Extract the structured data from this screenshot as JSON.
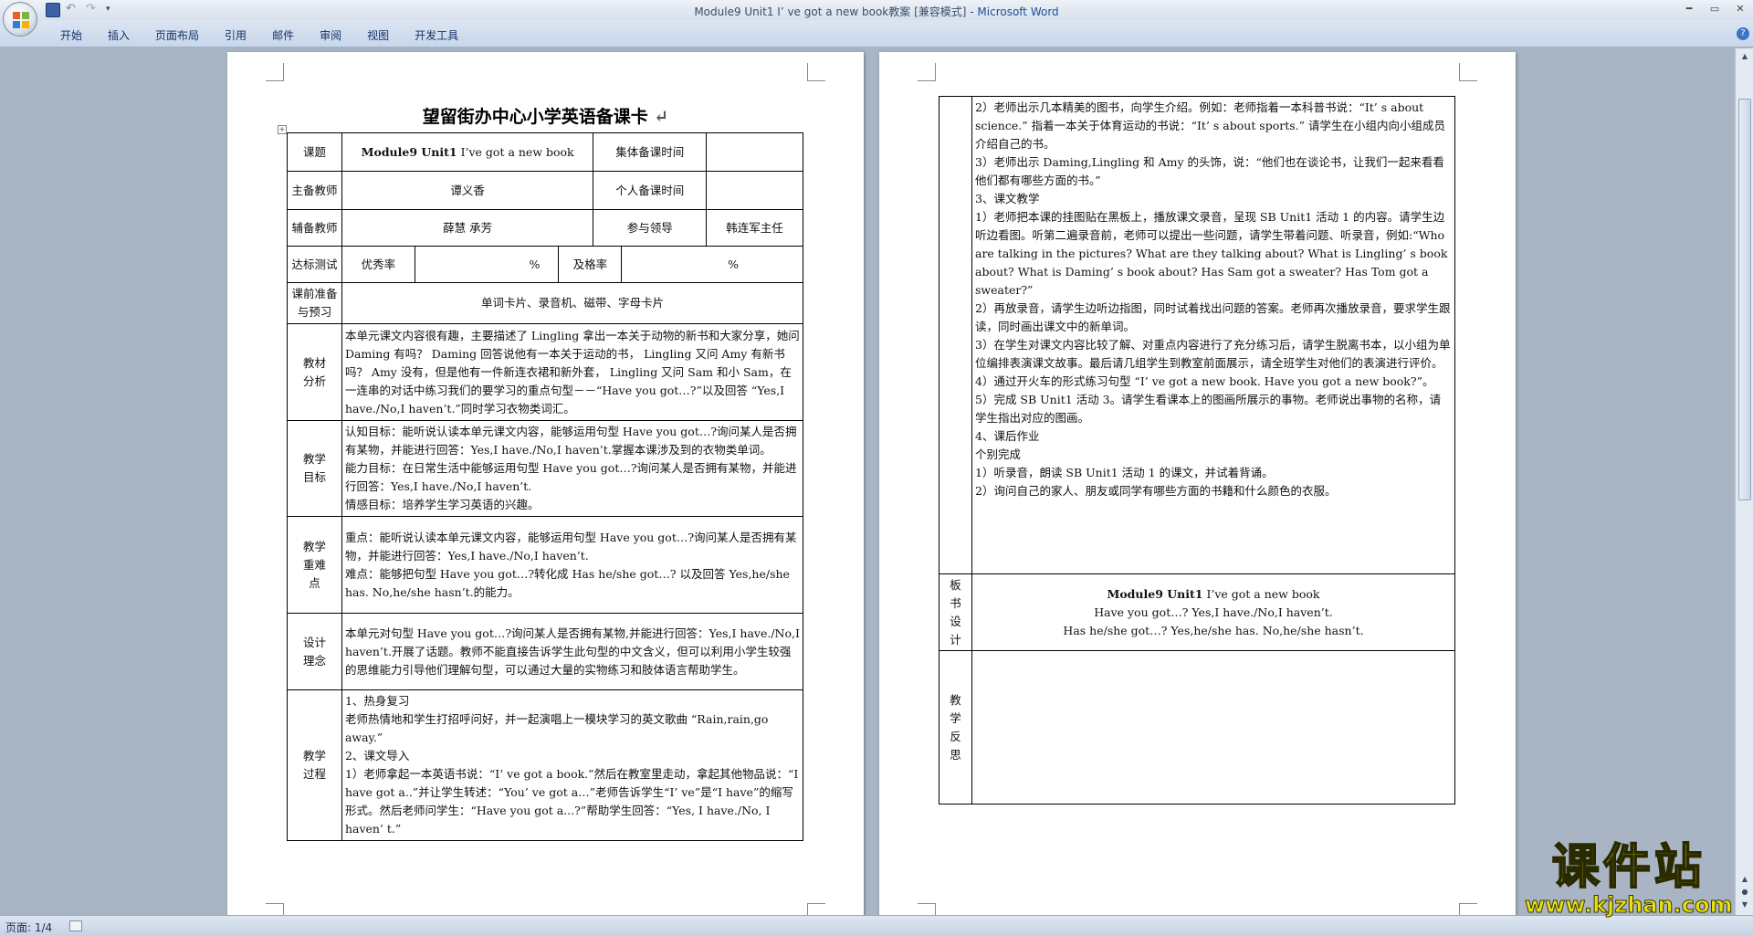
{
  "window": {
    "title": "Module9 Unit1 I’ ve got a new book教案 [兼容模式]",
    "app_name": "Microsoft Word",
    "separator": " - "
  },
  "ribbon": {
    "tabs": [
      "开始",
      "插入",
      "页面布局",
      "引用",
      "邮件",
      "审阅",
      "视图",
      "开发工具"
    ]
  },
  "status": {
    "page": "页面: 1/4"
  },
  "doc": {
    "title": "望留街办中心小学英语备课卡",
    "lesson_label": "课题",
    "lesson_value_bold": "Module9 Unit1",
    "lesson_value_rest": " I’ve got a new book",
    "collective_time_label": "集体备课时间",
    "main_teacher_label": "主备教师",
    "main_teacher_value": "谭义香",
    "personal_time_label": "个人备课时间",
    "assist_teacher_label": "辅备教师",
    "assist_teacher_value": "薛慧  承芳",
    "leader_label": "参与领导",
    "leader_value": "韩连军主任",
    "test_label": "达标测试",
    "excellent_label": "优秀率",
    "percent": "%",
    "pass_label": "及格率",
    "prep_label": "课前准备与预习",
    "prep_value": "单词卡片、录音机、磁带、字母卡片",
    "material_label": "教材分析",
    "material_text": "本单元课文内容很有趣，主要描述了 Lingling 拿出一本关于动物的新书和大家分享，她问 Daming 有吗？ Daming 回答说他有一本关于运动的书，  Lingling 又问  Amy 有新书吗？  Amy 没有，但是他有一件新连衣裙和新外套，   Lingling 又问  Sam 和小 Sam，在一连串的对话中练习我们的要学习的重点句型－－“Have you got…?”以及回答 “Yes,I have./No,I haven’t.”同时学习衣物类词汇。",
    "goal_label": "教学目标",
    "goal_lines": [
      "认知目标：能听说认读本单元课文内容，能够运用句型 Have you got…?询问某人是否拥有某物，并能进行回答：Yes,I have./No,I haven’t.掌握本课涉及到的衣物类单词。",
      "能力目标：在日常生活中能够运用句型 Have you got…?询问某人是否拥有某物，并能进行回答：Yes,I have./No,I haven’t.",
      "情感目标：培养学生学习英语的兴趣。"
    ],
    "key_label": "教学重难点",
    "key_lines": [
      "重点：能听说认读本单元课文内容，能够运用句型 Have you got…?询问某人是否拥有某物，并能进行回答：Yes,I have./No,I haven’t.",
      "难点：能够把句型 Have you got…?转化成 Has he/she got…? 以及回答 Yes,he/she has. No,he/she hasn’t.的能力。"
    ],
    "design_label": "设计理念",
    "design_text": "本单元对句型 Have you got…?询问某人是否拥有某物,并能进行回答：Yes,I have./No,I haven’t.开展了话题。教师不能直接告诉学生此句型的中文含义，但可以利用小学生较强的思维能力引导他们理解句型，可以通过大量的实物练习和肢体语言帮助学生。",
    "process_label": "教学过程",
    "process_left_lines": [
      "1、热身复习",
      "老师热情地和学生打招呼问好，并一起演唱上一模块学习的英文歌曲 “Rain,rain,go away.”",
      "2、课文导入",
      "1）老师拿起一本英语书说：“I’ ve got a book.”然后在教室里走动，拿起其他物品说：“I have got a..”并让学生转述：“You’ ve got a…”老师告诉学生“I’ ve”是“I have”的缩写形式。然后老师问学生：“Have you got a...?”帮助学生回答：“Yes, I have./No, I haven’ t.”"
    ],
    "process_right_lines": [
      "2）老师出示几本精美的图书，向学生介绍。例如：老师指着一本科普书说：“It’ s about science.” 指着一本关于体育运动的书说：“It’ s about sports.” 请学生在小组内向小组成员介绍自己的书。",
      "3）老师出示 Daming,Lingling 和 Amy 的头饰，说：“他们也在谈论书，让我们一起来看看他们都有哪些方面的书。”",
      "3、课文教学",
      "1）老师把本课的挂图贴在黑板上，播放课文录音，呈现 SB Unit1 活动 1 的内容。请学生边听边看图。听第二遍录音前，老师可以提出一些问题，请学生带着问题、听录音，例如:“Who are talking in the pictures? What are they talking about? What is Lingling’ s book about? What is Daming’ s book about? Has Sam got a sweater? Has Tom got a sweater?”",
      "2）再放录音，请学生边听边指图，同时试着找出问题的答案。老师再次播放录音，要求学生跟读，同时画出课文中的新单词。",
      "3）在学生对课文内容比较了解、对重点内容进行了充分练习后，请学生脱离书本，以小组为单位编排表演课文故事。最后请几组学生到教室前面展示，请全班学生对他们的表演进行评价。",
      "4）通过开火车的形式练习句型 “I’ ve got a new book. Have you got a new book?”。",
      "5）完成 SB  Unit1 活动 3。请学生看课本上的图画所展示的事物。老师说出事物的名称，请学生指出对应的图画。",
      "4、课后作业",
      "个别完成",
      "1）听录音，朗读 SB Unit1 活动 1 的课文，并试着背诵。",
      "2）询问自己的家人、朋友或同学有哪些方面的书籍和什么颜色的衣服。"
    ],
    "board_label": "板书设计",
    "board_line1_bold": "Module9 Unit1",
    "board_line1_rest": " I’ve got a new book",
    "board_line2": "Have you got…?      Yes,I have./No,I haven’t.",
    "board_line3": "Has he/she got…? Yes,he/she has. No,he/she hasn’t.",
    "reflect_label": "教学反思",
    "para_mark": "↵"
  },
  "watermark": {
    "text": "课件站",
    "url": "www.kjzhan.com"
  }
}
